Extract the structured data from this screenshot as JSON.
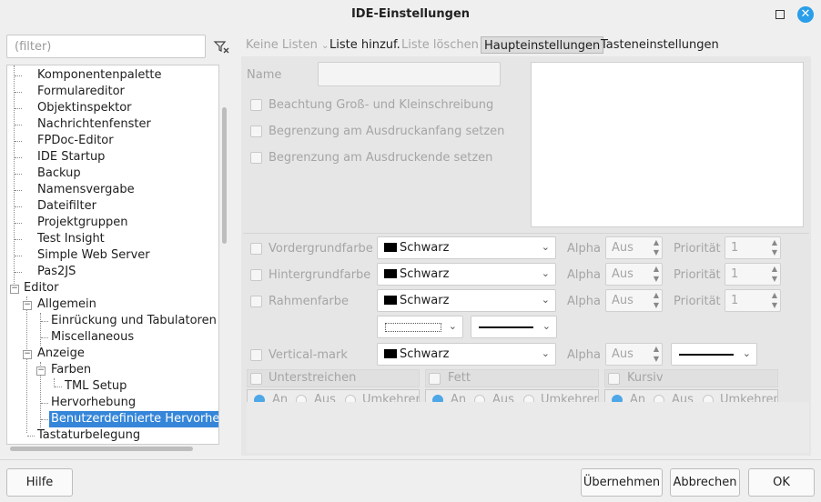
{
  "window": {
    "title": "IDE-Einstellungen"
  },
  "filter": {
    "placeholder": "(filter)"
  },
  "tree": {
    "items": [
      "Komponentenpalette",
      "Formulareditor",
      "Objektinspektor",
      "Nachrichtenfenster",
      "FPDoc-Editor",
      "IDE Startup",
      "Backup",
      "Namensvergabe",
      "Dateifilter",
      "Projektgruppen",
      "Test Insight",
      "Simple Web Server",
      "Pas2JS",
      "Editor",
      "Allgemein",
      "Einrückung und Tabulatoren",
      "Miscellaneous",
      "Anzeige",
      "Farben",
      "TML Setup",
      "Hervorhebung",
      "Benutzerdefinierte Hervorhebu",
      "Tastaturbelegung"
    ]
  },
  "toolbar": {
    "keine_listen": "Keine Listen",
    "liste_hinzuf": "Liste hinzuf.",
    "liste_loeschen": "Liste löschen",
    "tab_haupt": "Haupteinstellungen",
    "tab_tasten": "Tasteneinstellungen"
  },
  "form": {
    "name_label": "Name",
    "cb_case": "Beachtung Groß- und Kleinschreibung",
    "cb_start": "Begrenzung am Ausdruckanfang setzen",
    "cb_end": "Begrenzung am Ausdruckende setzen",
    "fg_label": "Vordergrundfarbe",
    "bg_label": "Hintergrundfarbe",
    "frame_label": "Rahmenfarbe",
    "vmark_label": "Vertical-mark",
    "color_value": "Schwarz",
    "alpha_label": "Alpha",
    "alpha_value": "Aus",
    "priority_label": "Priorität",
    "priority_value": "1",
    "underline_label": "Unterstreichen",
    "bold_label": "Fett",
    "italic_label": "Kursiv",
    "radio_on": "An",
    "radio_off": "Aus",
    "radio_invert": "Umkehren"
  },
  "buttons": {
    "help": "Hilfe",
    "apply": "Übernehmen",
    "cancel": "Abbrechen",
    "ok": "OK"
  },
  "colors": {
    "accent": "#3586d9",
    "close": "#2a9ee8"
  }
}
